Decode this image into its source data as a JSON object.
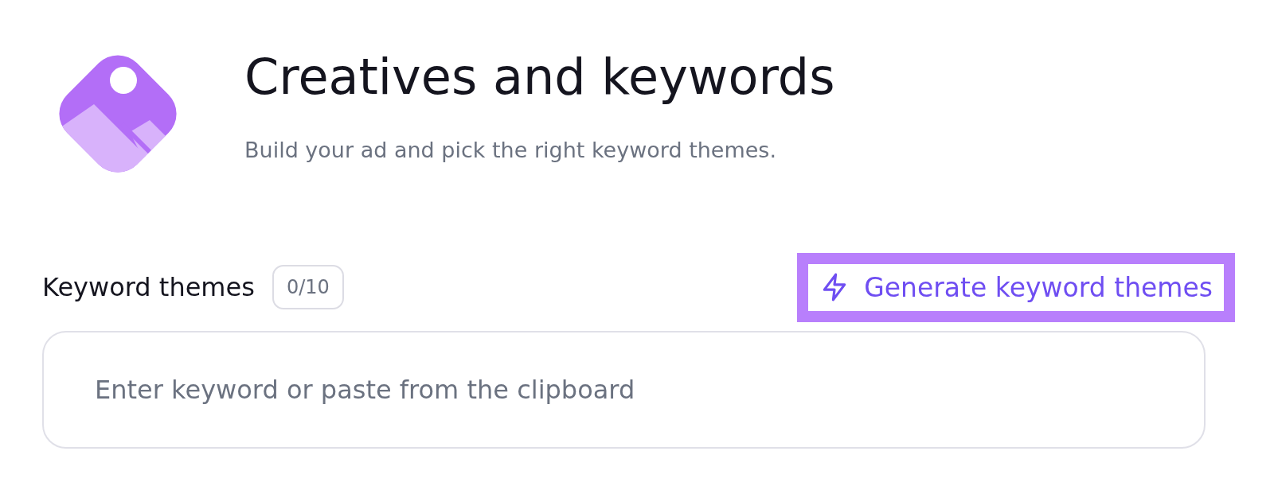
{
  "header": {
    "title": "Creatives and keywords",
    "subtitle": "Build your ad and pick the right keyword themes."
  },
  "keywords": {
    "label": "Keyword themes",
    "count": "0/10",
    "generate_button": "Generate keyword themes",
    "input": {
      "placeholder": "Enter keyword or paste from the clipboard"
    }
  }
}
